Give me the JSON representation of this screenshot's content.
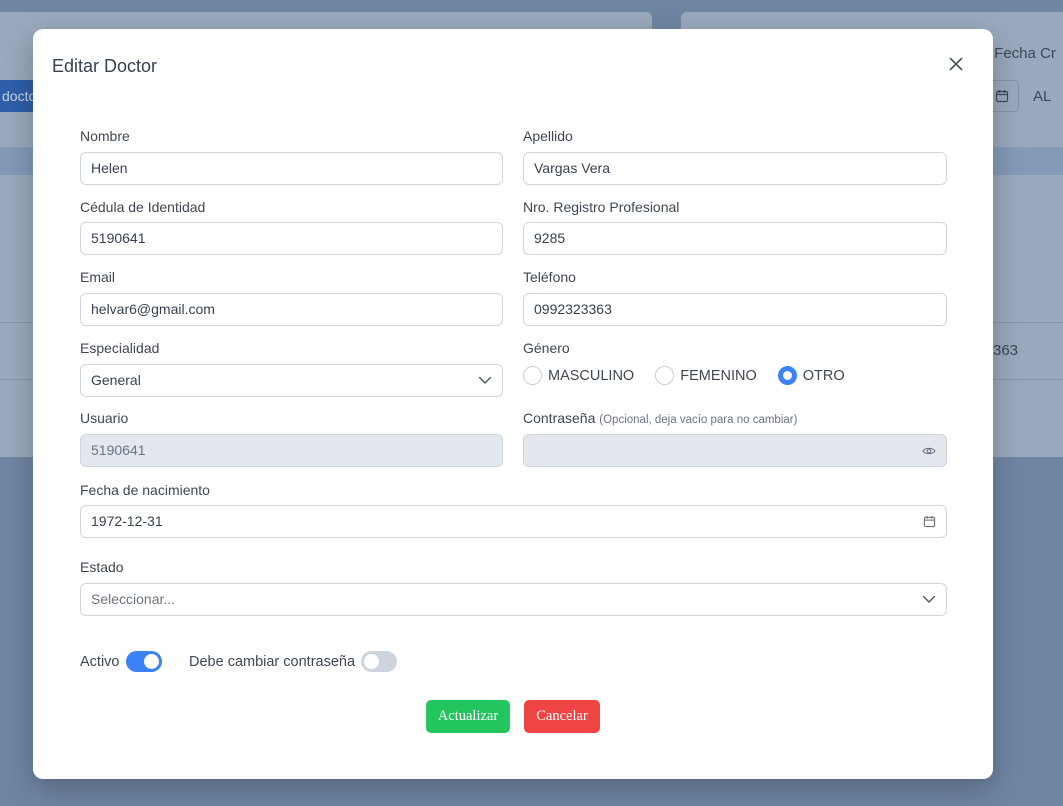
{
  "background": {
    "button_label": "doctor",
    "filter_label": "r Fecha Cr",
    "al_label": "AL",
    "cell_value": "363"
  },
  "modal": {
    "title": "Editar Doctor",
    "fields": {
      "nombre": {
        "label": "Nombre",
        "value": "Helen"
      },
      "apellido": {
        "label": "Apellido",
        "value": "Vargas Vera"
      },
      "cedula": {
        "label": "Cédula de Identidad",
        "value": "5190641"
      },
      "registro": {
        "label": "Nro. Registro Profesional",
        "value": "9285"
      },
      "email": {
        "label": "Email",
        "value": "helvar6@gmail.com"
      },
      "telefono": {
        "label": "Teléfono",
        "value": "0992323363"
      },
      "especialidad": {
        "label": "Especialidad",
        "value": "General"
      },
      "genero": {
        "label": "Género",
        "options": [
          "MASCULINO",
          "FEMENINO",
          "OTRO"
        ],
        "selected": "OTRO"
      },
      "usuario": {
        "label": "Usuario",
        "value": "5190641"
      },
      "contrasena": {
        "label": "Contraseña",
        "hint": "(Opcional, deja vacío para no cambiar)",
        "value": ""
      },
      "fecha_nacimiento": {
        "label": "Fecha de nacimiento",
        "value": "1972-12-31"
      },
      "estado": {
        "label": "Estado",
        "placeholder": "Seleccionar..."
      }
    },
    "toggles": {
      "activo": {
        "label": "Activo",
        "on": true
      },
      "cambiar_contrasena": {
        "label": "Debe cambiar contraseña",
        "on": false
      }
    },
    "buttons": {
      "update": "Actualizar",
      "cancel": "Cancelar"
    }
  },
  "colors": {
    "accent": "#3b82f6",
    "success": "#22c55e",
    "danger": "#ef4444",
    "overlay": "#6f86a3"
  },
  "icons": {
    "close": "close-icon",
    "chevron": "chevron-down-icon",
    "calendar": "calendar-icon",
    "eye": "eye-icon"
  }
}
